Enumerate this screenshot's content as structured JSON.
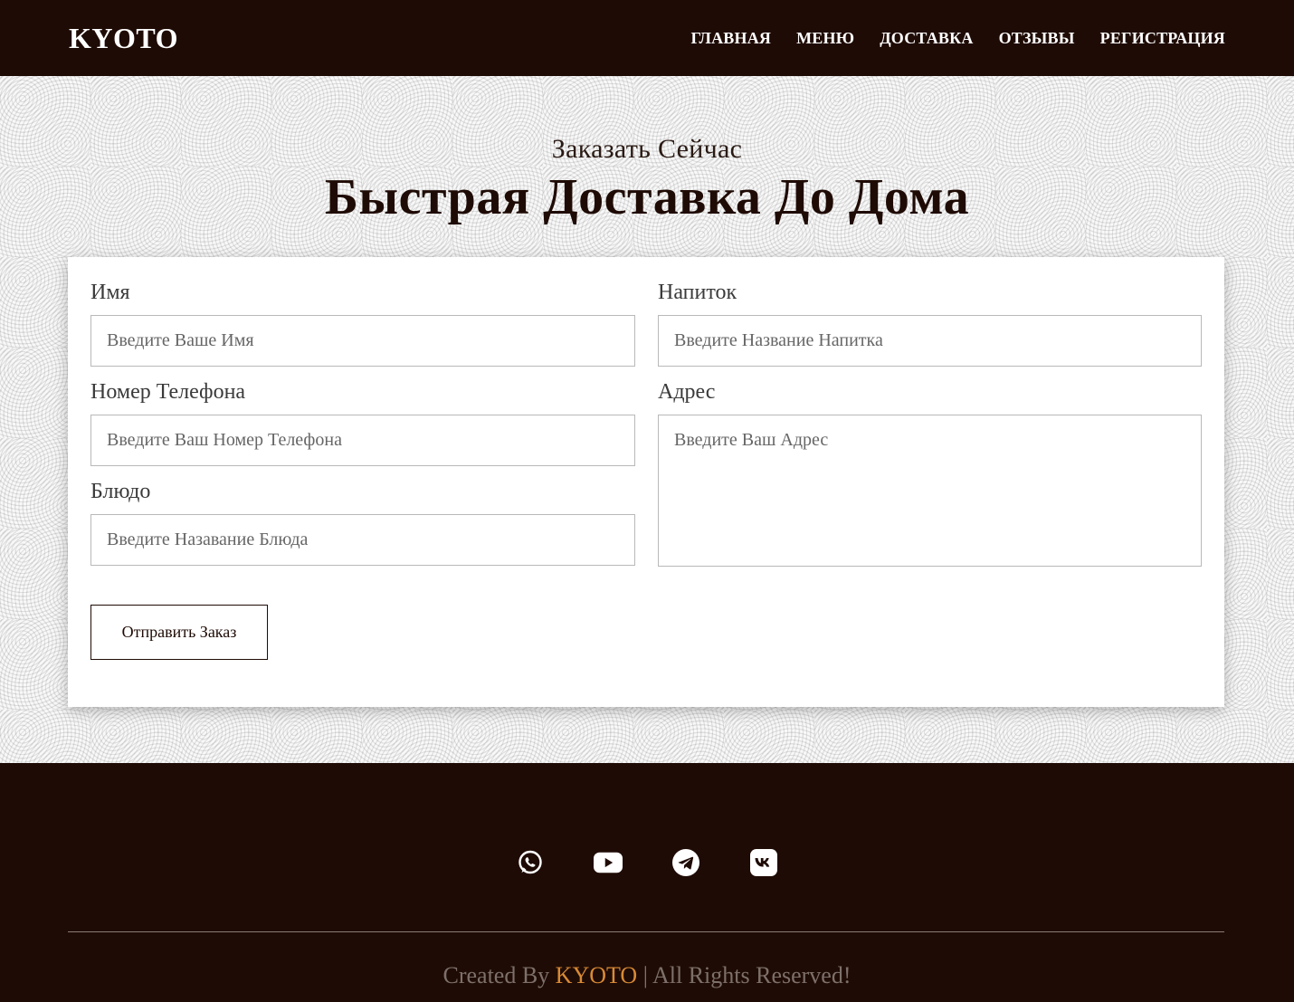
{
  "header": {
    "logo": "KYOTO",
    "nav": [
      "ГЛАВНАЯ",
      "МЕНЮ",
      "ДОСТАВКА",
      "ОТЗЫВЫ",
      "РЕГИСТРАЦИЯ"
    ]
  },
  "hero": {
    "subtitle": "Заказать Сейчас",
    "title": "Быстрая Доставка До Дома"
  },
  "form": {
    "name_label": "Имя",
    "name_placeholder": "Введите Ваше Имя",
    "phone_label": "Номер Телефона",
    "phone_placeholder": "Введите Ваш Номер Телефона",
    "dish_label": "Блюдо",
    "dish_placeholder": "Введите Назавание Блюда",
    "drink_label": "Напиток",
    "drink_placeholder": "Введите Название Напитка",
    "address_label": "Адрес",
    "address_placeholder": "Введите Ваш Адрес",
    "submit_label": "Отправить Заказ"
  },
  "footer": {
    "socials": [
      "whatsapp-icon",
      "youtube-icon",
      "telegram-icon",
      "vk-icon"
    ],
    "copyright_prefix": "Created By ",
    "copyright_brand": "KYOTO",
    "copyright_suffix": " | All Rights Reserved!",
    "brand_color": "#d88a35"
  },
  "colors": {
    "dark_brown": "#1f0b05",
    "white": "#ffffff"
  }
}
